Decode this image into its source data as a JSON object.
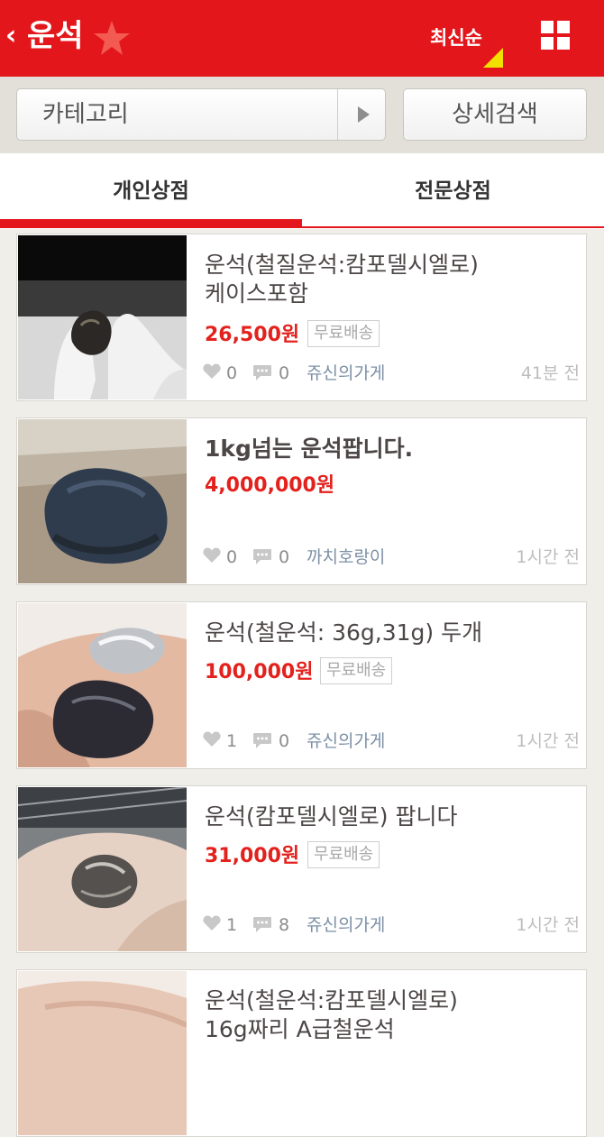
{
  "header": {
    "back_glyph": "‹",
    "title": "운석",
    "sort_label": "최신순",
    "colors": {
      "brand": "#e3171b",
      "sort_indicator": "#f2e100"
    }
  },
  "search": {
    "category_label": "카테고리",
    "detail_search_label": "상세검색"
  },
  "tabs": [
    {
      "label": "개인상점",
      "active": true
    },
    {
      "label": "전문상점",
      "active": false
    }
  ],
  "items": [
    {
      "title_line1": "운석(철질운석:캄포델시엘로)",
      "title_line2": "케이스포함",
      "price": "26,500원",
      "badge": "무료배송",
      "likes": "0",
      "comments": "0",
      "shop": "쥬신의가게",
      "time": "41분 전"
    },
    {
      "title_line1": "1kg넘는 운석팝니다.",
      "price": "4,000,000원",
      "likes": "0",
      "comments": "0",
      "shop": "까치호랑이",
      "time": "1시간 전"
    },
    {
      "title_line1": "운석(철운석: 36g,31g) 두개",
      "price": "100,000원",
      "badge": "무료배송",
      "likes": "1",
      "comments": "0",
      "shop": "쥬신의가게",
      "time": "1시간 전"
    },
    {
      "title_line1": "운석(캄포델시엘로) 팝니다",
      "price": "31,000원",
      "badge": "무료배송",
      "likes": "1",
      "comments": "8",
      "shop": "쥬신의가게",
      "time": "1시간 전"
    },
    {
      "title_line1": "운석(철운석:캄포델시엘로)",
      "title_line2": "16g짜리 A급철운석"
    }
  ]
}
